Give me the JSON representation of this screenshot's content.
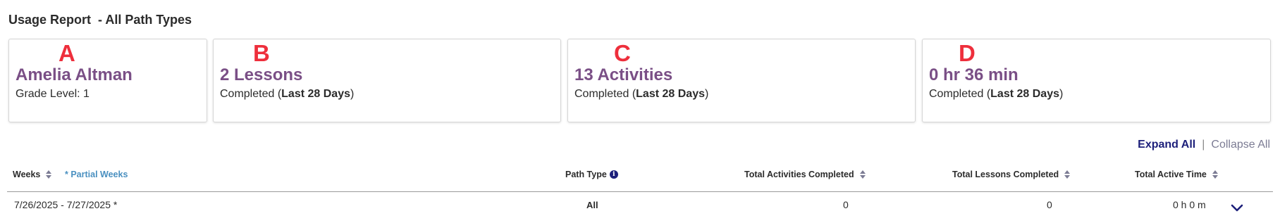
{
  "page": {
    "title": "Usage Report  - All Path Types"
  },
  "cards": [
    {
      "letter": "A",
      "value": "Amelia Altman",
      "subtitle_prefix": "Grade Level: 1",
      "subtitle_bold": "",
      "subtitle_suffix": ""
    },
    {
      "letter": "B",
      "value": "2 Lessons",
      "subtitle_prefix": "Completed (",
      "subtitle_bold": "Last 28 Days",
      "subtitle_suffix": ")"
    },
    {
      "letter": "C",
      "value": "13 Activities",
      "subtitle_prefix": "Completed (",
      "subtitle_bold": "Last 28 Days",
      "subtitle_suffix": ")"
    },
    {
      "letter": "D",
      "value": "0 hr 36 min",
      "subtitle_prefix": "Completed (",
      "subtitle_bold": "Last 28 Days",
      "subtitle_suffix": ")"
    }
  ],
  "controls": {
    "expand_all": "Expand All",
    "separator": "|",
    "collapse_all": "Collapse All"
  },
  "table": {
    "headers": {
      "weeks": "Weeks",
      "partial_weeks": "* Partial Weeks",
      "path_type": "Path Type",
      "info_glyph": "i",
      "total_activities": "Total Activities Completed",
      "total_lessons": "Total Lessons Completed",
      "total_active_time": "Total Active Time"
    },
    "rows": [
      {
        "weeks": "7/26/2025 - 7/27/2025 *",
        "path_type": "All",
        "total_activities": "0",
        "total_lessons": "0",
        "total_active_time": "0 h 0 m"
      }
    ]
  },
  "colors": {
    "accent_purple": "#7a4f86",
    "letter_red": "#ee2f3c",
    "link_navy": "#1c1f7a",
    "link_blue": "#4a90c0"
  },
  "icons": {
    "sort": "sort-icon",
    "info": "info-icon",
    "expand_row": "chevron-down-icon"
  }
}
